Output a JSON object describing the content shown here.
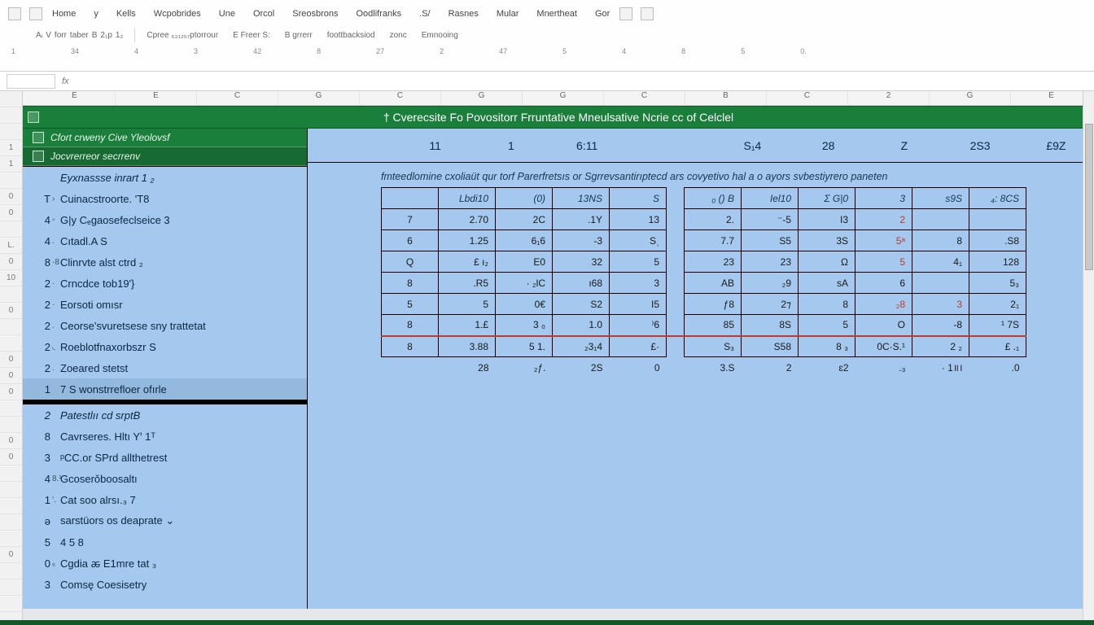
{
  "ribbon": {
    "tabs_row1": [
      "Home",
      "y",
      "Kells",
      "Wcpobrides",
      "Une",
      "Orcol",
      "Sreosbrons",
      "Oodlifranks",
      ".S/",
      "Rasnes",
      "Mular",
      "Mnertheat",
      "Gor"
    ],
    "tabs_row2_left": [
      "Aᵢ",
      "V",
      "forr",
      "taber",
      "B",
      "2₁p",
      "1₂"
    ],
    "tabs_row2_right": [
      "Cpree ₅₃₁₂₅₇ptorrour",
      "E Freer  S:",
      "B grrerr",
      "foottbacksiod",
      "zonc",
      "Emnooing"
    ],
    "small_numbers": [
      "1",
      "34",
      "4",
      "3",
      "42",
      "8",
      "27",
      "2",
      "47",
      "5",
      "4",
      "8",
      "5",
      "0."
    ],
    "ctrls": [
      "′",
      "┐",
      "„„"
    ]
  },
  "cols": [
    "E",
    "E",
    "C",
    "G",
    "C",
    "G",
    "G",
    "C",
    "B",
    "C",
    "2",
    "G",
    "E"
  ],
  "rowhdrs": [
    "",
    "",
    "",
    "1",
    "1",
    "",
    "0",
    "0",
    "",
    "L.",
    "0",
    "10",
    "",
    "0",
    "",
    "",
    "0",
    "0",
    "0",
    "",
    "",
    "0",
    "0",
    "",
    "",
    "",
    "",
    "",
    "0"
  ],
  "greenbar": {
    "title": "† Cverecsite Fo Povositorr Frruntative Mneulsative Ncrie cc of Celclel"
  },
  "greentabs": [
    {
      "label": "Cfort crweny Cive Yleolovsf",
      "icon": true
    },
    {
      "label": "Jocvrerreor secrrenv",
      "icon": true,
      "alt": true
    }
  ],
  "number_strip": [
    "11",
    "1",
    "6:11",
    "S₁4",
    "28",
    "Z",
    "2S3",
    "£9Z"
  ],
  "desc": "fmteedlomine cxoliaüt qur torf Parerfretsıs or Sgrrevsantirıptecd ars covyetivo hal a o ayors svbestiyrero paneten",
  "cats": [
    {
      "num": "",
      "sub": "",
      "label": "Eyxnassse inrart 1 ₂",
      "head": true
    },
    {
      "num": "T",
      "sub": "›",
      "label": "Cuinacstroorte.  'T8"
    },
    {
      "num": "4",
      "sub": "◦",
      "label": "G|y Cₑgaosefeclseice 3"
    },
    {
      "num": "4",
      "sub": ".",
      "label": "Cıtadl.A S"
    },
    {
      "num": "8",
      "sub": "·8",
      "label": "Clinrvte alst ctrd  ₂"
    },
    {
      "num": "2",
      "sub": "·",
      "label": "Crncdce tob19'}"
    },
    {
      "num": "2",
      "sub": "·",
      "label": "Eorsoti omısr"
    },
    {
      "num": "2",
      "sub": ".",
      "label": "Ceorse'svuretsese sny trattetat"
    },
    {
      "num": "2",
      "sub": "◟",
      "label": "Roeblotfnaxorbszr S"
    },
    {
      "num": "2",
      "sub": ".",
      "label": "Zoeared stetst"
    },
    {
      "num": "1",
      "sub": "",
      "label": "7 S wonstrrefloer ofırle",
      "light": true
    },
    {
      "num": "2",
      "sub": "",
      "label": "Patestlıı cd srptB",
      "head": true,
      "postsep": true
    },
    {
      "num": "8",
      "sub": "",
      "label": "Cavrseres. Hltı Yꞌ   1ᵀ"
    },
    {
      "num": "3",
      "sub": "",
      "label": "ᵖCC.or SPrd allthetrest"
    },
    {
      "num": "4",
      "sub": "8.¹",
      "label": "Gcoserǒboosaltı"
    },
    {
      "num": "1",
      "sub": "‘.",
      "label": "Cat soo alrsı.₃ 7"
    },
    {
      "num": "ə",
      "sub": "",
      "label": "sarstüors os deaprate  ⌄"
    },
    {
      "num": "5",
      "sub": "",
      "label": "4 5 8"
    },
    {
      "num": "0",
      "sub": "₅",
      "label": "Cgdia ꬱ E1mre tat ₃"
    },
    {
      "num": "3",
      "sub": "",
      "label": "Comsę Coesisetry"
    }
  ],
  "table": {
    "headers1": [
      "Lbdi10",
      "(0)",
      "13NS",
      "S",
      "₀ () B",
      "Iel10",
      "Σ  G|0",
      "3",
      "s9S",
      "₄:  8CS"
    ],
    "rows": [
      {
        "r": "7",
        "c": [
          "2.70",
          "2C",
          ".1Y",
          "13",
          "2.",
          "⁻-5",
          "I3",
          "2",
          "",
          ""
        ],
        "red": [
          7
        ]
      },
      {
        "r": "6",
        "c": [
          "1.25",
          "6₁6",
          "-3",
          "Sˌ",
          "7.7",
          "S5",
          "3S",
          "5ᵃ",
          "8",
          ".S8"
        ],
        "red": [
          7
        ]
      },
      {
        "r": "Q",
        "c": [
          "£ ı₂",
          "E0",
          "32",
          "5",
          "23",
          "23",
          "Ω",
          "5",
          "4₁",
          "128"
        ],
        "red": [
          7
        ]
      },
      {
        "r": "8",
        "c": [
          ".R5",
          "· ₂lС",
          "ı68",
          "3",
          "AB",
          "₂9",
          "sA",
          "6",
          "",
          "5₃"
        ]
      },
      {
        "r": "5",
        "c": [
          "5",
          "0€",
          "S2",
          "I5",
          "ƒ8",
          "2⁊",
          "8",
          "₂8",
          "3",
          "2₁"
        ],
        "red": [
          7,
          8
        ]
      },
      {
        "r": "8",
        "c": [
          "1.£",
          "3 ₀",
          "1.0",
          "⁾6",
          "85",
          "8S",
          "5",
          "O",
          "-8",
          "¹ 7S"
        ]
      },
      {
        "r": "8",
        "c": [
          "3.88",
          "5 1.",
          "₂3₁4",
          "£·",
          "S₃",
          "S58",
          "8 ₃",
          "0C·S.¹",
          "2 ₂",
          "£ .₁"
        ],
        "totals": true
      }
    ],
    "footer": [
      "28",
      "₂ƒ.",
      "2S",
      "0",
      "3.S",
      "2",
      "ɛ2",
      ".₃",
      "· 1॥।",
      ".0"
    ]
  }
}
